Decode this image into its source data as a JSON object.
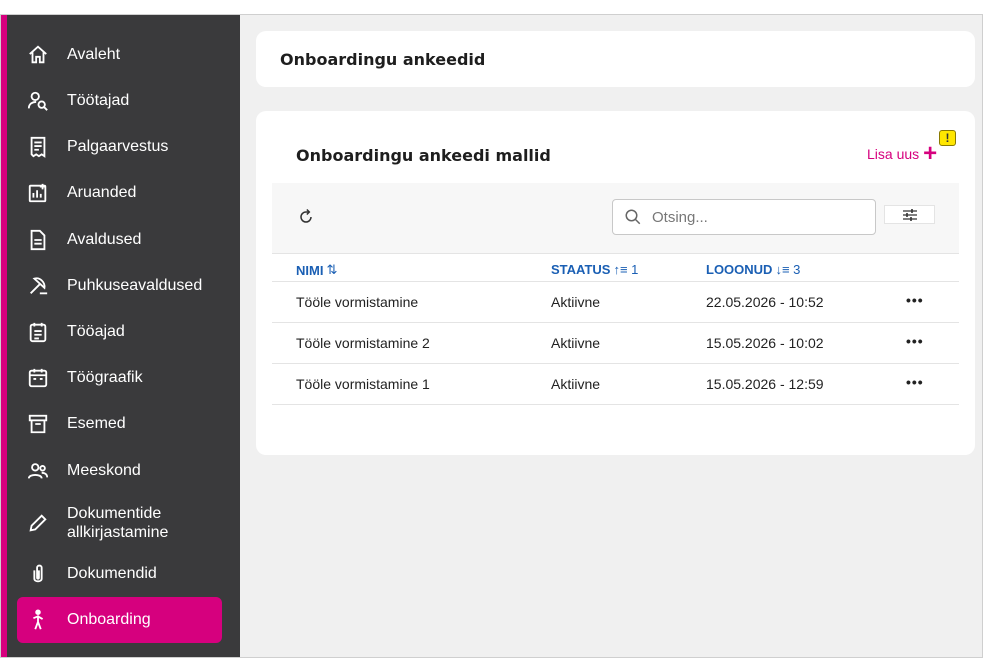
{
  "sidebar": {
    "items": [
      {
        "label": "Avaleht",
        "icon": "home-icon"
      },
      {
        "label": "Töötajad",
        "icon": "employee-search-icon"
      },
      {
        "label": "Palgaarvestus",
        "icon": "receipt-icon"
      },
      {
        "label": "Aruanded",
        "icon": "report-chart-icon"
      },
      {
        "label": "Avaldused",
        "icon": "document-icon"
      },
      {
        "label": "Puhkuseavaldused",
        "icon": "beach-umbrella-icon"
      },
      {
        "label": "Tööajad",
        "icon": "schedule-icon"
      },
      {
        "label": "Töögraafik",
        "icon": "calendar-icon"
      },
      {
        "label": "Esemed",
        "icon": "archive-box-icon"
      },
      {
        "label": "Meeskond",
        "icon": "team-icon"
      },
      {
        "label": "Dokumentide allkirjastamine",
        "icon": "pen-icon"
      },
      {
        "label": "Dokumendid",
        "icon": "paperclip-icon"
      },
      {
        "label": "Onboarding",
        "icon": "person-walking-icon"
      }
    ],
    "active": "Onboarding"
  },
  "header": {
    "title": "Onboardingu ankeedid"
  },
  "main": {
    "section_title": "Onboardingu ankeedi mallid",
    "add_label": "Lisa uus",
    "warning_badge": "!",
    "search": {
      "placeholder": "Otsing..."
    },
    "table": {
      "columns": [
        {
          "label": "NIMI",
          "sort": "⇅"
        },
        {
          "label": "STAATUS",
          "sort": "↑≡ 1"
        },
        {
          "label": "LOOONUD",
          "sort": "↓≡ 3"
        }
      ],
      "rows": [
        {
          "name": "Tööle vormistamine",
          "status": "Aktiivne",
          "created": "22.05.2026 - 10:52",
          "actions": "•••"
        },
        {
          "name": "Tööle vormistamine 2",
          "status": "Aktiivne",
          "created": "15.05.2026 - 10:02",
          "actions": "•••"
        },
        {
          "name": "Tööle vormistamine 1",
          "status": "Aktiivne",
          "created": "15.05.2026 - 12:59",
          "actions": "•••"
        }
      ]
    }
  },
  "colors": {
    "accent": "#d6007e",
    "sidebar_bg": "#3a3a3c",
    "link_blue": "#1a5fb4"
  }
}
